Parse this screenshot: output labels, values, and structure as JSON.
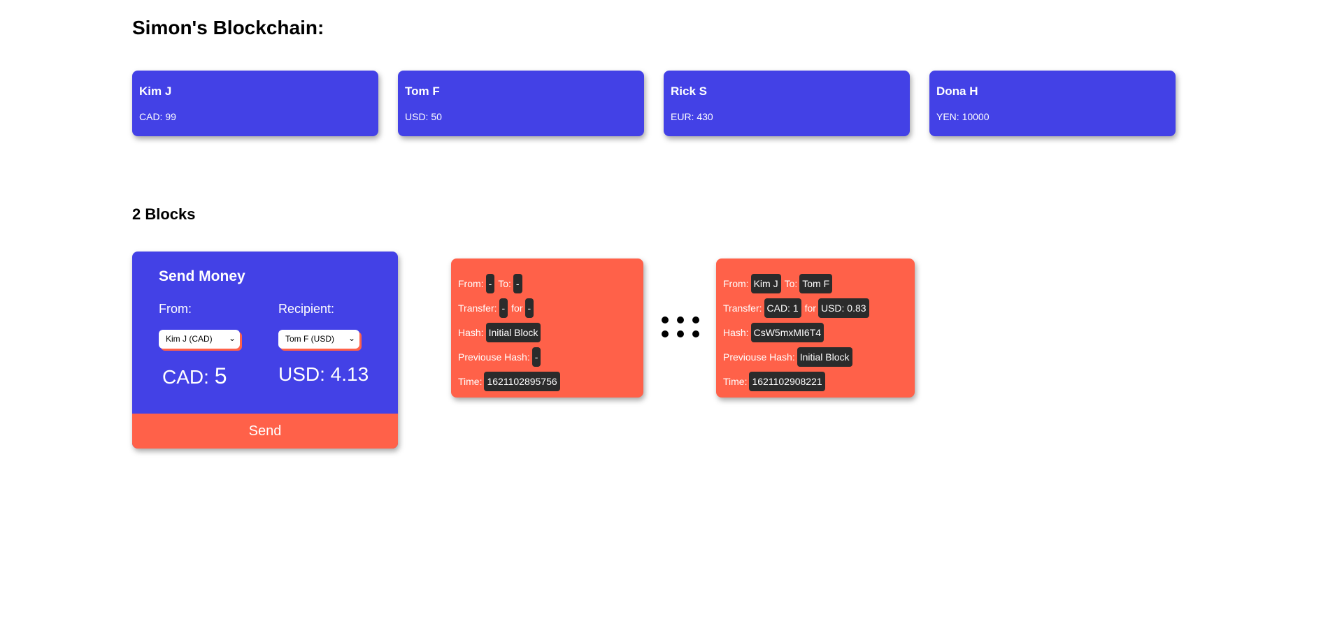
{
  "title": "Simon's Blockchain:",
  "users": [
    {
      "name": "Kim J",
      "balance": "CAD: 99"
    },
    {
      "name": "Tom F",
      "balance": "USD: 50"
    },
    {
      "name": "Rick S",
      "balance": "EUR: 430"
    },
    {
      "name": "Dona H",
      "balance": "YEN: 10000"
    }
  ],
  "blocks_heading": "2 Blocks",
  "send_form": {
    "title": "Send Money",
    "from_label": "From:",
    "recipient_label": "Recipient:",
    "from_selected": "Kim J (CAD)",
    "recipient_selected": "Tom F (USD)",
    "from_currency": "CAD:",
    "from_amount": "5",
    "to_amount": "USD: 4.13",
    "send_label": "Send"
  },
  "labels": {
    "from": "From:",
    "to": "To:",
    "transfer": "Transfer:",
    "for": "for",
    "hash": "Hash:",
    "prev_hash": "Previouse Hash:",
    "time": "Time:"
  },
  "blocks": [
    {
      "from": "-",
      "to": "-",
      "transfer": "-",
      "for": "-",
      "hash": "Initial Block",
      "prev_hash": "-",
      "time": "1621102895756"
    },
    {
      "from": "Kim J",
      "to": "Tom F",
      "transfer": "CAD: 1",
      "for": "USD: 0.83",
      "hash": "CsW5mxMI6T4",
      "prev_hash": "Initial Block",
      "time": "1621102908221"
    }
  ],
  "colors": {
    "primary": "#4341e6",
    "accent": "#ff6149",
    "chip": "#2b2b2b"
  }
}
